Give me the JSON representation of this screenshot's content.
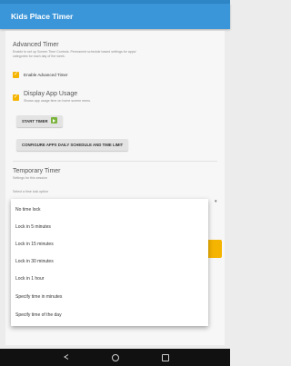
{
  "app": {
    "title": "Kids Place Timer"
  },
  "advanced_timer": {
    "title": "Advanced Timer",
    "description_line1": "Enable to set up Screen Time Controls. Permanent schedule based settings for apps/",
    "description_line2": "categories for each day of the week.",
    "enable_label": "Enable Advanced Timer",
    "enable_checked": true
  },
  "display_usage": {
    "title": "Display App Usage",
    "description": "Shows app usage time on home screen menu.",
    "checked": true
  },
  "buttons": {
    "start_timer": "START TIMER",
    "configure": "CONFIGURE APPS DAILY SCHEDULE AND TIME LIMIT"
  },
  "temporary_timer": {
    "title": "Temporary Timer",
    "subtitle": "Settings for this session",
    "select_label": "Select a time lock option"
  },
  "dropdown": {
    "options": [
      "No time lock",
      "Lock in 5 minutes",
      "Lock in 15 minutes",
      "Lock in 30 minutes",
      "Lock in 1 hour",
      "Specify time in minutes",
      "Specify time of the day"
    ]
  },
  "colors": {
    "appbar": "#3a95d9",
    "accent": "#f5b400",
    "start_icon": "#7ab33a"
  },
  "icons": {
    "start_timer": "play-icon",
    "nav": [
      "back-icon",
      "home-icon",
      "recents-icon"
    ]
  }
}
